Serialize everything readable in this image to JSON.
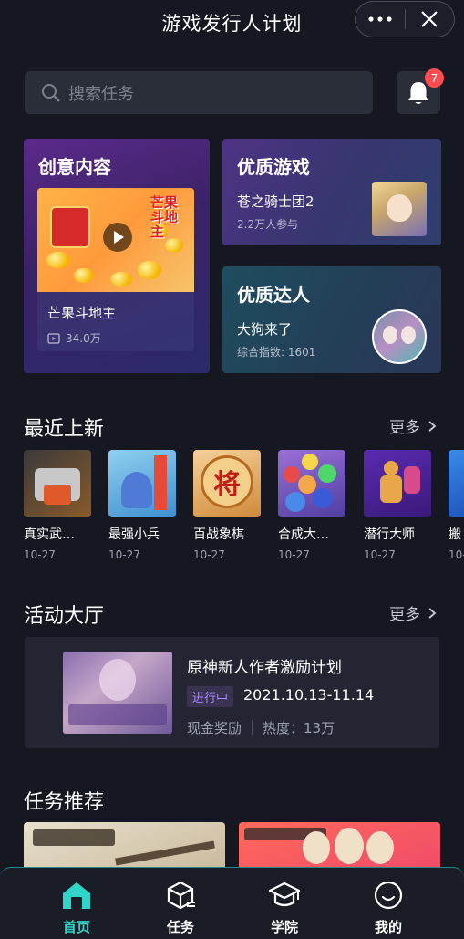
{
  "header": {
    "title": "游戏发行人计划",
    "more_icon": "more-dots-icon",
    "close_icon": "close-icon"
  },
  "search": {
    "placeholder": "搜索任务",
    "icon": "search-icon"
  },
  "notifications": {
    "icon": "bell-icon",
    "count": "7"
  },
  "featured": {
    "creative": {
      "title": "创意内容",
      "item_name": "芒果斗地主",
      "plays": "34.0万",
      "logo_text": "芒果斗地主"
    },
    "quality_game": {
      "title": "优质游戏",
      "item_name": "苍之骑士团2",
      "participants": "2.2万人参与"
    },
    "quality_talent": {
      "title": "优质达人",
      "item_name": "大狗来了",
      "score": "综合指数: 1601"
    }
  },
  "recent": {
    "title": "最近上新",
    "more": "更多",
    "games": [
      {
        "name": "真实武…",
        "date": "10-27",
        "color": "#5a4a3a"
      },
      {
        "name": "最强小兵",
        "date": "10-27",
        "color": "#5aa0d8"
      },
      {
        "name": "百战象棋",
        "date": "10-27",
        "color": "#e8b56a"
      },
      {
        "name": "合成大…",
        "date": "10-27",
        "color": "#6a4fb0"
      },
      {
        "name": "潜行大师",
        "date": "10-27",
        "color": "#7a3fbf"
      },
      {
        "name": "搬",
        "date": "10-",
        "color": "#2a6ee0"
      }
    ]
  },
  "events": {
    "title": "活动大厅",
    "more": "更多",
    "item": {
      "title": "原神新人作者激励计划",
      "status": "进行中",
      "date_range": "2021.10.13-11.14",
      "reward": "现金奖励",
      "heat": "热度：13万"
    }
  },
  "tasks": {
    "title": "任务推荐"
  },
  "nav": {
    "items": [
      {
        "label": "首页",
        "icon": "home-icon",
        "active": true
      },
      {
        "label": "任务",
        "icon": "task-box-icon",
        "active": false
      },
      {
        "label": "学院",
        "icon": "graduation-cap-icon",
        "active": false
      },
      {
        "label": "我的",
        "icon": "smile-face-icon",
        "active": false
      }
    ]
  },
  "colors": {
    "accent": "#2fd5c8",
    "badge": "#ff4d4f",
    "status_tag": "#a98bff"
  }
}
